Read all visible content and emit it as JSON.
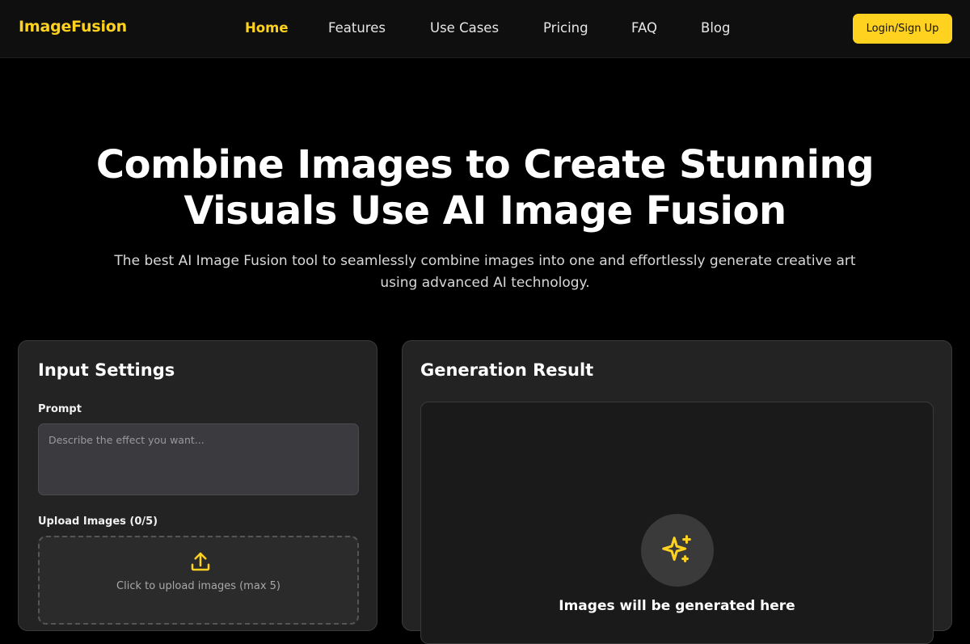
{
  "header": {
    "logo": "ImageFusion",
    "nav": [
      {
        "label": "Home",
        "active": true
      },
      {
        "label": "Features"
      },
      {
        "label": "Use Cases"
      },
      {
        "label": "Pricing"
      },
      {
        "label": "FAQ"
      },
      {
        "label": "Blog"
      }
    ],
    "login_label": "Login/Sign Up"
  },
  "hero": {
    "title_line1": "Combine Images to Create Stunning",
    "title_line2": "Visuals Use AI Image Fusion",
    "subtitle_line1": "The best AI Image Fusion tool to seamlessly combine images into one and effortlessly generate creative art",
    "subtitle_line2": "using advanced AI technology."
  },
  "input_panel": {
    "title": "Input Settings",
    "prompt_label": "Prompt",
    "prompt_placeholder": "Describe the effect you want...",
    "prompt_value": "",
    "upload_label": "Upload Images (0/5)",
    "upload_icon": "upload-icon",
    "upload_text": "Click to upload images (max 5)"
  },
  "result_panel": {
    "title": "Generation Result",
    "icon": "sparkle-icon",
    "placeholder_text": "Images will be generated here"
  },
  "colors": {
    "accent": "#FFD21F",
    "background": "#000000",
    "panel": "#232323"
  }
}
